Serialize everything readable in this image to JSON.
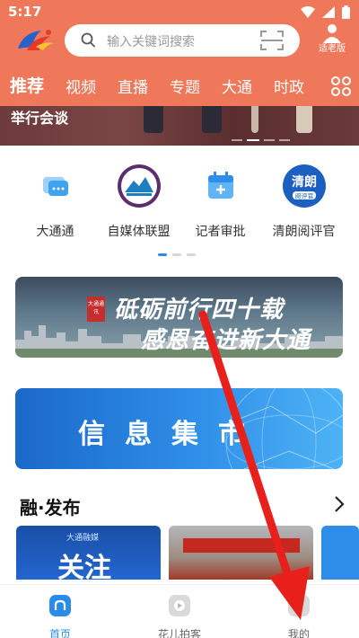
{
  "status_bar": {
    "time": "5:17"
  },
  "header": {
    "search_placeholder": "输入关键词搜索",
    "elder_mode_label": "适老版",
    "tabs": [
      "推荐",
      "视频",
      "直播",
      "专题",
      "大通",
      "时政"
    ]
  },
  "banner": {
    "caption": "举行会谈"
  },
  "quick_entries": [
    {
      "label": "大通通",
      "icon": "chat-bubble-icon"
    },
    {
      "label": "自媒体联盟",
      "icon": "mountain-emblem-icon"
    },
    {
      "label": "记者审批",
      "icon": "calendar-plus-icon"
    },
    {
      "label": "清朗阅评官",
      "icon": "qinglang-badge-icon"
    }
  ],
  "promo1": {
    "line1": "砥砺前行四十载",
    "line2": "感恩奋进新大通",
    "badge": "大通通讯"
  },
  "promo2": {
    "text": "信息集市"
  },
  "section": {
    "title": "融·发布"
  },
  "cards": {
    "card1_brand": "大通融媒",
    "card1_title": "关注"
  },
  "bottom_nav": [
    {
      "label": "首页",
      "icon": "home-icon",
      "active": true
    },
    {
      "label": "花儿拍客",
      "icon": "video-play-icon",
      "active": false
    },
    {
      "label": "我的",
      "icon": "profile-icon",
      "active": false
    }
  ],
  "colors": {
    "header_bg": "#f0785a",
    "accent_blue": "#2b8be8",
    "arrow_red": "#e8201c"
  }
}
